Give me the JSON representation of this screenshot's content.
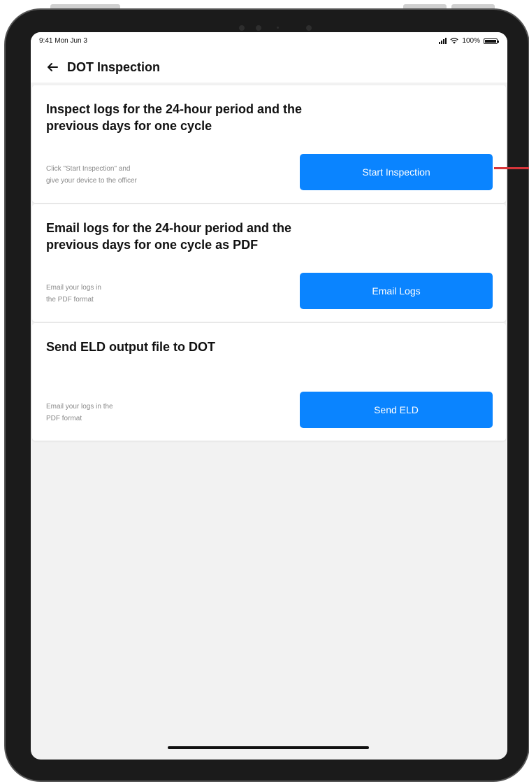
{
  "status_bar": {
    "time": "9:41 Mon Jun 3",
    "battery": "100%"
  },
  "header": {
    "back_icon": "arrow-left-icon",
    "title": "DOT Inspection"
  },
  "cards": [
    {
      "title": "Inspect logs for the 24-hour period and the previous days for one cycle",
      "description_line1": "Click \"Start Inspection\" and",
      "description_line2": "give your device to the officer",
      "button": "Start Inspection"
    },
    {
      "title": "Email logs for the 24-hour period and the previous days for one cycle as PDF",
      "description_line1": "Email your logs in",
      "description_line2": "the PDF format",
      "button": "Email Logs"
    },
    {
      "title": "Send ELD output file to DOT",
      "description_line1": "Email your logs in the",
      "description_line2": "PDF format",
      "button": "Send ELD"
    }
  ],
  "colors": {
    "accent": "#0a84ff",
    "background": "#f2f2f2",
    "marker": "#d6353a"
  }
}
